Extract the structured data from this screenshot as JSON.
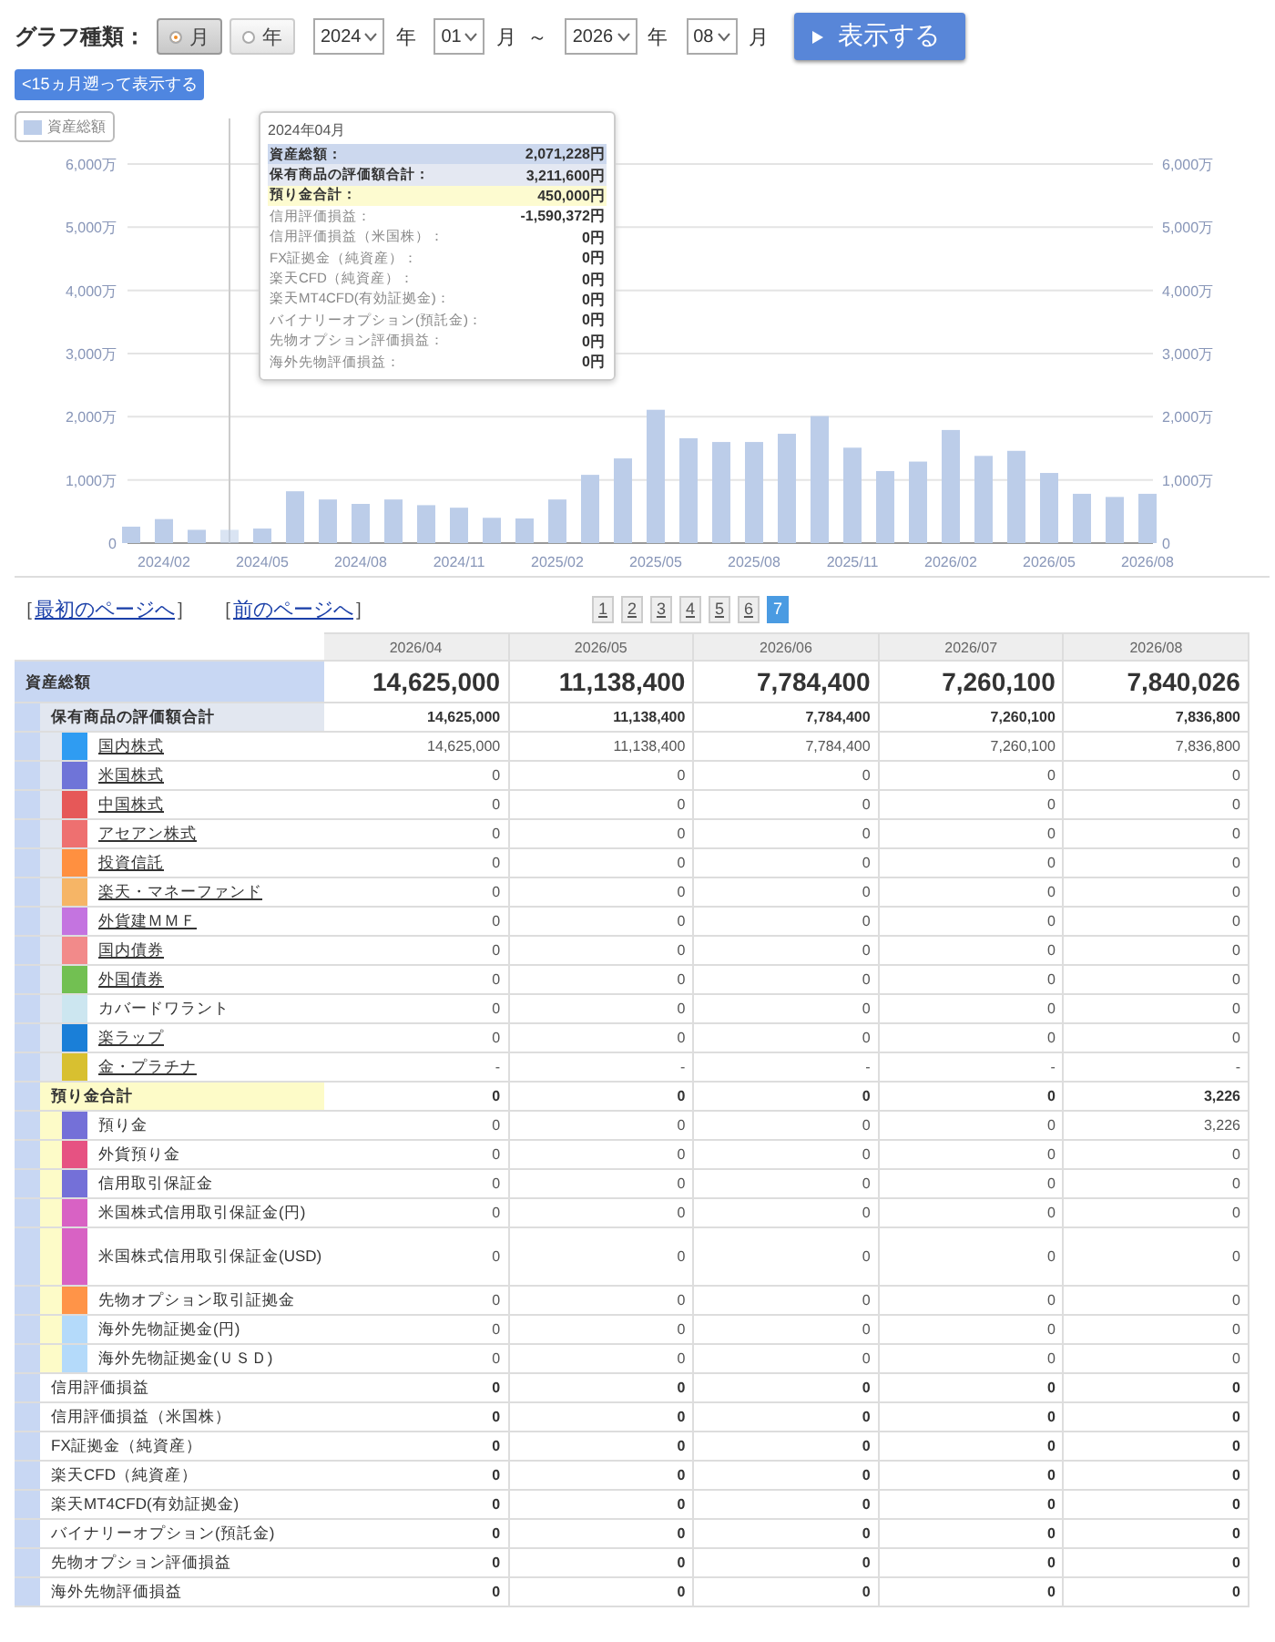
{
  "controls": {
    "label": "グラフ種類：",
    "radios": [
      {
        "label": "月",
        "selected": true
      },
      {
        "label": "年",
        "selected": false
      }
    ],
    "range": [
      {
        "kind": "select",
        "value": "2024"
      },
      {
        "kind": "text",
        "text": "年"
      },
      {
        "kind": "select",
        "value": "01"
      },
      {
        "kind": "text",
        "text": "月"
      },
      {
        "kind": "text",
        "text": "～"
      },
      {
        "kind": "select",
        "value": "2026"
      },
      {
        "kind": "text",
        "text": "年"
      },
      {
        "kind": "select",
        "value": "08"
      },
      {
        "kind": "text",
        "text": "月"
      }
    ],
    "show_button": "表示する",
    "back_button": "<15ヵ月遡って表示する"
  },
  "chart": {
    "bar_hovered": [
      false,
      false,
      false,
      true,
      false,
      false,
      false,
      false,
      false,
      false,
      false,
      false,
      false,
      false,
      false,
      false,
      false,
      false,
      false,
      false,
      false,
      false,
      false,
      false,
      false,
      false,
      false,
      false,
      false,
      false,
      false,
      false
    ],
    "right_axis_labels": [
      "6,000万",
      "5,000万",
      "4,000万",
      "3,000万",
      "2,000万",
      "1,000万",
      "0"
    ],
    "tooltip": {
      "title": "2024年04月",
      "rows": [
        {
          "kind": "total",
          "label": "資産総額：",
          "value": "2,071,228円"
        },
        {
          "kind": "holdings",
          "label": "保有商品の評価額合計：",
          "value": "3,211,600円"
        },
        {
          "kind": "deposits",
          "label": "預り金合計：",
          "value": "450,000円"
        },
        {
          "kind": "plain",
          "label": "信用評価損益：",
          "value": "-1,590,372円"
        },
        {
          "kind": "plain",
          "label": "信用評価損益（米国株）：",
          "value": "0円"
        },
        {
          "kind": "plain",
          "label": "FX証拠金（純資産）：",
          "value": "0円"
        },
        {
          "kind": "plain",
          "label": "楽天CFD（純資産）：",
          "value": "0円"
        },
        {
          "kind": "plain",
          "label": "楽天MT4CFD(有効証拠金)：",
          "value": "0円"
        },
        {
          "kind": "plain",
          "label": "バイナリーオプション(預託金)：",
          "value": "0円"
        },
        {
          "kind": "plain",
          "label": "先物オプション評価損益：",
          "value": "0円"
        },
        {
          "kind": "plain",
          "label": "海外先物評価損益：",
          "value": "0円"
        }
      ]
    },
    "chart_data": {
      "type": "bar",
      "categories": [
        null,
        "2024/02",
        null,
        null,
        "2024/05",
        null,
        null,
        "2024/08",
        null,
        null,
        "2024/11",
        null,
        null,
        "2025/02",
        null,
        null,
        "2025/05",
        null,
        null,
        "2025/08",
        null,
        null,
        "2025/11",
        null,
        null,
        "2026/02",
        null,
        null,
        "2026/05",
        null,
        null,
        "2026/08"
      ],
      "series": [
        {
          "name": "資産総額",
          "color": "#bccde9",
          "values": [
            260,
            380,
            210,
            210,
            230,
            820,
            690,
            620,
            690,
            600,
            560,
            400,
            390,
            690,
            1080,
            1340,
            2110,
            1660,
            1600,
            1600,
            1730,
            2010,
            1510,
            1140,
            1290,
            1790,
            1380,
            1460,
            1110,
            780,
            730,
            780
          ]
        }
      ],
      "ylim": [
        0,
        6000
      ],
      "grid": true,
      "yticks": [
        {
          "value": 6000,
          "label": "6,000万"
        },
        {
          "value": 5000,
          "label": "5,000万"
        },
        {
          "value": 4000,
          "label": "4,000万"
        },
        {
          "value": 3000,
          "label": "3,000万"
        },
        {
          "value": 2000,
          "label": "2,000万"
        },
        {
          "value": 1000,
          "label": "1,000万"
        },
        {
          "value": 0,
          "label": "0"
        }
      ]
    }
  },
  "nav_links": [
    {
      "open": "［",
      "label": "最初のページへ",
      "close": "］"
    },
    {
      "open": "［",
      "label": "前のページへ",
      "close": "］"
    }
  ],
  "pages": [
    {
      "label": "1",
      "selected": false
    },
    {
      "label": "2",
      "selected": false
    },
    {
      "label": "3",
      "selected": false
    },
    {
      "label": "4",
      "selected": false
    },
    {
      "label": "5",
      "selected": false
    },
    {
      "label": "6",
      "selected": false
    },
    {
      "label": "7",
      "selected": true
    }
  ],
  "table": {
    "columns": [
      "2026/04",
      "2026/05",
      "2026/06",
      "2026/07",
      "2026/08"
    ],
    "total": {
      "label": "資産総額",
      "values": [
        "14,625,000",
        "11,138,400",
        "7,784,400",
        "7,260,100",
        "7,840,026"
      ],
      "children": [
        {
          "kind": "holdings",
          "label": "保有商品の評価額合計",
          "values": [
            "14,625,000",
            "11,138,400",
            "7,784,400",
            "7,260,100",
            "7,836,800"
          ],
          "children": [
            {
              "label": "国内株式",
              "color": "#2f9cf2",
              "link": true,
              "values": [
                "14,625,000",
                "11,138,400",
                "7,784,400",
                "7,260,100",
                "7,836,800"
              ]
            },
            {
              "label": "米国株式",
              "color": "#6f74d8",
              "link": true,
              "values": [
                "0",
                "0",
                "0",
                "0",
                "0"
              ]
            },
            {
              "label": "中国株式",
              "color": "#e65858",
              "link": true,
              "values": [
                "0",
                "0",
                "0",
                "0",
                "0"
              ]
            },
            {
              "label": "アセアン株式",
              "color": "#ee7070",
              "link": true,
              "values": [
                "0",
                "0",
                "0",
                "0",
                "0"
              ]
            },
            {
              "label": "投資信託",
              "color": "#ff9040",
              "link": true,
              "values": [
                "0",
                "0",
                "0",
                "0",
                "0"
              ]
            },
            {
              "label": "楽天・マネーファンド",
              "color": "#f6b566",
              "link": true,
              "values": [
                "0",
                "0",
                "0",
                "0",
                "0"
              ]
            },
            {
              "label": "外貨建ＭＭＦ",
              "color": "#c474e0",
              "link": true,
              "values": [
                "0",
                "0",
                "0",
                "0",
                "0"
              ]
            },
            {
              "label": "国内債券",
              "color": "#f28a8a",
              "link": true,
              "values": [
                "0",
                "0",
                "0",
                "0",
                "0"
              ]
            },
            {
              "label": "外国債券",
              "color": "#72c052",
              "link": true,
              "values": [
                "0",
                "0",
                "0",
                "0",
                "0"
              ]
            },
            {
              "label": "カバードワラント",
              "color": "#cce6f0",
              "link": false,
              "values": [
                "0",
                "0",
                "0",
                "0",
                "0"
              ]
            },
            {
              "label": "楽ラップ",
              "color": "#1a7fd8",
              "link": true,
              "values": [
                "0",
                "0",
                "0",
                "0",
                "0"
              ]
            },
            {
              "label": "金・プラチナ",
              "color": "#d8c030",
              "link": true,
              "values": [
                "-",
                "-",
                "-",
                "-",
                "-"
              ]
            }
          ]
        },
        {
          "kind": "deposits",
          "label": "預り金合計",
          "values": [
            "0",
            "0",
            "0",
            "0",
            "3,226"
          ],
          "children": [
            {
              "label": "預り金",
              "color": "#7470d8",
              "link": false,
              "values": [
                "0",
                "0",
                "0",
                "0",
                "3,226"
              ]
            },
            {
              "label": "外貨預り金",
              "color": "#e65282",
              "link": false,
              "values": [
                "0",
                "0",
                "0",
                "0",
                "0"
              ]
            },
            {
              "label": "信用取引保証金",
              "color": "#7470d8",
              "link": false,
              "values": [
                "0",
                "0",
                "0",
                "0",
                "0"
              ]
            },
            {
              "label": "米国株式信用取引保証金(円)",
              "color": "#d862c4",
              "link": false,
              "values": [
                "0",
                "0",
                "0",
                "0",
                "0"
              ]
            },
            {
              "label": "米国株式信用取引保証金(USD)",
              "color": "#d862c4",
              "link": false,
              "values": [
                "0",
                "0",
                "0",
                "0",
                "0"
              ]
            },
            {
              "label": "先物オプション取引証拠金",
              "color": "#ff9448",
              "link": false,
              "values": [
                "0",
                "0",
                "0",
                "0",
                "0"
              ]
            },
            {
              "label": "海外先物証拠金(円)",
              "color": "#b4dafa",
              "link": false,
              "values": [
                "0",
                "0",
                "0",
                "0",
                "0"
              ]
            },
            {
              "label": "海外先物証拠金(ＵＳＤ)",
              "color": "#b4dafa",
              "link": false,
              "values": [
                "0",
                "0",
                "0",
                "0",
                "0"
              ]
            }
          ]
        },
        {
          "kind": "plain",
          "label": "信用評価損益",
          "values": [
            "0",
            "0",
            "0",
            "0",
            "0"
          ]
        },
        {
          "kind": "plain",
          "label": "信用評価損益（米国株）",
          "values": [
            "0",
            "0",
            "0",
            "0",
            "0"
          ]
        },
        {
          "kind": "plain",
          "label": "FX証拠金（純資産）",
          "values": [
            "0",
            "0",
            "0",
            "0",
            "0"
          ]
        },
        {
          "kind": "plain",
          "label": "楽天CFD（純資産）",
          "values": [
            "0",
            "0",
            "0",
            "0",
            "0"
          ]
        },
        {
          "kind": "plain",
          "label": "楽天MT4CFD(有効証拠金)",
          "values": [
            "0",
            "0",
            "0",
            "0",
            "0"
          ]
        },
        {
          "kind": "plain",
          "label": "バイナリーオプション(預託金)",
          "values": [
            "0",
            "0",
            "0",
            "0",
            "0"
          ]
        },
        {
          "kind": "plain",
          "label": "先物オプション評価損益",
          "values": [
            "0",
            "0",
            "0",
            "0",
            "0"
          ]
        },
        {
          "kind": "plain",
          "label": "海外先物評価損益",
          "values": [
            "0",
            "0",
            "0",
            "0",
            "0"
          ]
        }
      ]
    }
  }
}
